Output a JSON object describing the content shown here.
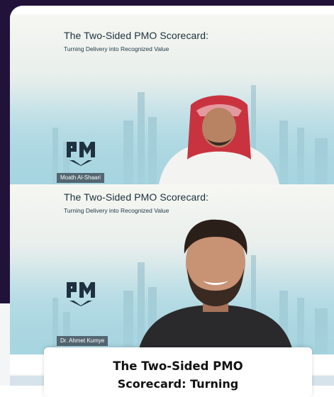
{
  "tiles": [
    {
      "slide_title": "The Two-Sided PMO Scorecard:",
      "slide_subtitle": "Turning Delivery into Recognized Value",
      "participant_name": "Moath Al-Shaari"
    },
    {
      "slide_title": "The Two-Sided PMO Scorecard:",
      "slide_subtitle": "Turning Delivery into Recognized Value",
      "participant_name": "Dr. Ahmet Kumye"
    }
  ],
  "logo_icon": "pm-logo-icon",
  "overlay": {
    "title": "The Two-Sided PMO",
    "subtitle": "Scorecard: Turning"
  },
  "colors": {
    "background_dark": "#21123a",
    "sky_top": "#f6f7f2",
    "sky_bottom": "#9fd0dc",
    "logo": "#1f3140"
  }
}
